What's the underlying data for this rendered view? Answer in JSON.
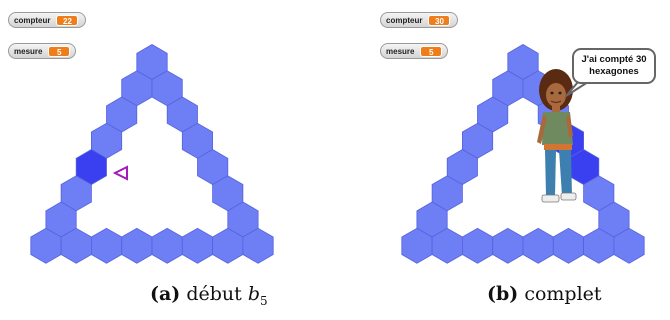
{
  "panel_a": {
    "counter": {
      "label": "compteur",
      "value": "22"
    },
    "measure": {
      "label": "mesure",
      "value": "5"
    },
    "caption_tag": "(a)",
    "caption_text": "début ",
    "caption_var": "b",
    "caption_sub": "5"
  },
  "panel_b": {
    "counter": {
      "label": "compteur",
      "value": "30"
    },
    "measure": {
      "label": "mesure",
      "value": "5"
    },
    "caption_tag": "(b)",
    "caption_text": "complet",
    "speech": "J'ai compté 30 hexagones"
  },
  "colors": {
    "hex_fill": "#6e7ef5",
    "hex_dark": "#3a3ff0",
    "hex_stroke": "#5562dc",
    "sprite_arrow": "#a21cb8"
  },
  "icons": {
    "sprite_a": "triangle-pointer-icon",
    "sprite_b": "girl-character-icon"
  }
}
